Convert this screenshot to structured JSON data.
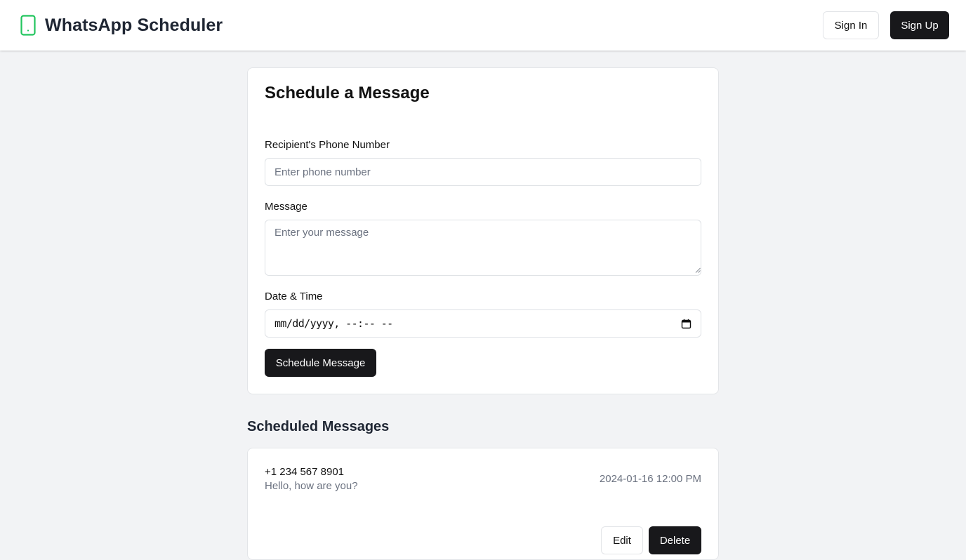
{
  "header": {
    "brand_icon": "smartphone-icon",
    "title": "WhatsApp Scheduler",
    "sign_in_label": "Sign In",
    "sign_up_label": "Sign Up"
  },
  "form": {
    "title": "Schedule a Message",
    "phone_label": "Recipient's Phone Number",
    "phone_placeholder": "Enter phone number",
    "message_label": "Message",
    "message_placeholder": "Enter your message",
    "datetime_label": "Date & Time",
    "datetime_placeholder": "mm/dd/yyyy, --:-- --",
    "submit_label": "Schedule Message"
  },
  "scheduled": {
    "title": "Scheduled Messages",
    "items": [
      {
        "phone": "+1 234 567 8901",
        "message": "Hello, how are you?",
        "datetime": "2024-01-16 12:00 PM",
        "edit_label": "Edit",
        "delete_label": "Delete"
      }
    ]
  },
  "colors": {
    "accent_green": "#22c55e",
    "dark_button": "#18181b",
    "page_background": "#f2f3f5"
  }
}
